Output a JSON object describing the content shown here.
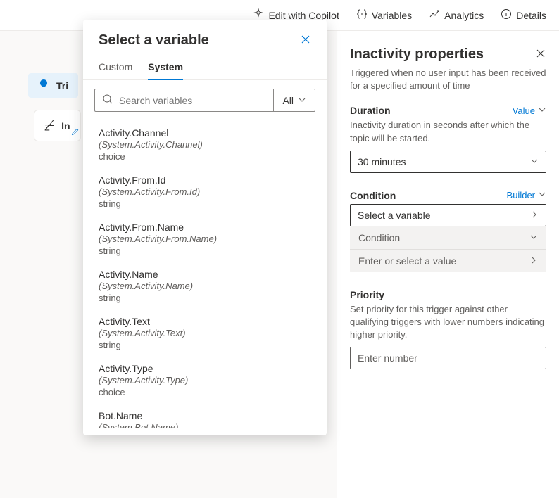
{
  "topbar": {
    "copilot": "Edit with Copilot",
    "variables": "Variables",
    "analytics": "Analytics",
    "details": "Details"
  },
  "canvas": {
    "trigger_label": "Tri",
    "inactivity_label": "In"
  },
  "popover": {
    "title": "Select a variable",
    "tabs": {
      "custom": "Custom",
      "system": "System"
    },
    "search_placeholder": "Search variables",
    "filter_label": "All",
    "items": [
      {
        "name": "Activity.Channel",
        "sys": "(System.Activity.Channel)",
        "type": "choice"
      },
      {
        "name": "Activity.From.Id",
        "sys": "(System.Activity.From.Id)",
        "type": "string"
      },
      {
        "name": "Activity.From.Name",
        "sys": "(System.Activity.From.Name)",
        "type": "string"
      },
      {
        "name": "Activity.Name",
        "sys": "(System.Activity.Name)",
        "type": "string"
      },
      {
        "name": "Activity.Text",
        "sys": "(System.Activity.Text)",
        "type": "string"
      },
      {
        "name": "Activity.Type",
        "sys": "(System.Activity.Type)",
        "type": "choice"
      },
      {
        "name": "Bot.Name",
        "sys": "(System.Bot.Name)",
        "type": ""
      }
    ]
  },
  "panel": {
    "title": "Inactivity properties",
    "desc": "Triggered when no user input has been received for a specified amount of time",
    "duration": {
      "title": "Duration",
      "link": "Value",
      "desc": "Inactivity duration in seconds after which the topic will be started.",
      "value": "30 minutes"
    },
    "condition": {
      "title": "Condition",
      "link": "Builder",
      "select_placeholder": "Select a variable",
      "cond_placeholder": "Condition",
      "value_placeholder": "Enter or select a value"
    },
    "priority": {
      "title": "Priority",
      "desc": "Set priority for this trigger against other qualifying triggers with lower numbers indicating higher priority.",
      "placeholder": "Enter number"
    }
  }
}
